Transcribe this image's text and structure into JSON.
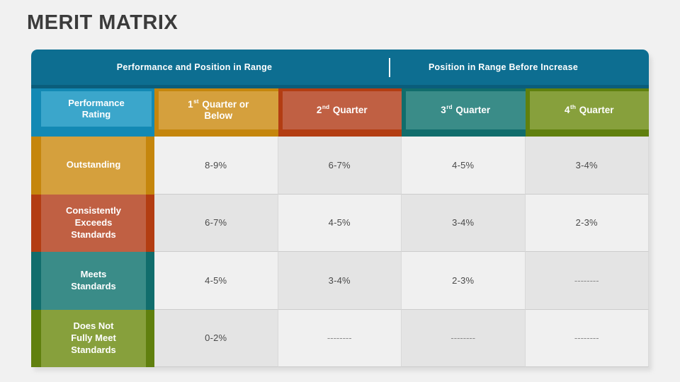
{
  "title": "MERIT MATRIX",
  "banner": {
    "left_label": "Performance and Position in Range",
    "right_label": "Position in Range Before Increase",
    "color": "#0d6e91"
  },
  "columns": [
    {
      "id": "rating",
      "label": "Performance Rating",
      "line1": "Performance",
      "line2": "Rating",
      "base_color": "#1389b4",
      "panel_color": "#3ba6cb"
    },
    {
      "id": "q1",
      "label": "1st Quarter or Below",
      "num": "1",
      "ord": "st",
      "rest": " Quarter or",
      "line2": "Below",
      "base_color": "#c5860d",
      "panel_color": "#d5a03d"
    },
    {
      "id": "q2",
      "label": "2nd Quarter",
      "num": "2",
      "ord": "nd",
      "rest": " Quarter",
      "line2": "",
      "base_color": "#b33d12",
      "panel_color": "#c06043"
    },
    {
      "id": "q3",
      "label": "3rd Quarter",
      "num": "3",
      "ord": "rd",
      "rest": " Quarter",
      "line2": "",
      "base_color": "#116d6c",
      "panel_color": "#3a8c88"
    },
    {
      "id": "q4",
      "label": "4th Quarter",
      "num": "4",
      "ord": "th",
      "rest": " Quarter",
      "line2": "",
      "base_color": "#60800e",
      "panel_color": "#87a03c"
    }
  ],
  "rows": [
    {
      "id": "outstanding",
      "label": "Outstanding",
      "lines": [
        "Outstanding"
      ],
      "base_color": "#c5860d",
      "panel_color": "#d5a03d",
      "values": [
        "8-9%",
        "6-7%",
        "4-5%",
        "3-4%"
      ]
    },
    {
      "id": "consistently-exceeds-standards",
      "label": "Consistently Exceeds Standards",
      "lines": [
        "Consistently",
        "Exceeds",
        "Standards"
      ],
      "base_color": "#b33d12",
      "panel_color": "#c06043",
      "values": [
        "6-7%",
        "4-5%",
        "3-4%",
        "2-3%"
      ]
    },
    {
      "id": "meets-standards",
      "label": "Meets Standards",
      "lines": [
        "Meets",
        "Standards"
      ],
      "base_color": "#116d6c",
      "panel_color": "#3a8c88",
      "values": [
        "4-5%",
        "3-4%",
        "2-3%",
        "--------"
      ]
    },
    {
      "id": "does-not-fully-meet-standards",
      "label": "Does Not Fully Meet Standards",
      "lines": [
        "Does Not",
        "Fully Meet",
        "Standards"
      ],
      "base_color": "#60800e",
      "panel_color": "#87a03c",
      "values": [
        "0-2%",
        "--------",
        "--------",
        "--------"
      ]
    }
  ],
  "chart_data": {
    "type": "table",
    "title": "MERIT MATRIX",
    "xlabel": "Position in Range Before Increase",
    "ylabel": "Performance Rating",
    "categories": [
      "1st Quarter or Below",
      "2nd Quarter",
      "3rd Quarter",
      "4th Quarter"
    ],
    "series": [
      {
        "name": "Outstanding",
        "values": [
          "8-9%",
          "6-7%",
          "4-5%",
          "3-4%"
        ]
      },
      {
        "name": "Consistently Exceeds Standards",
        "values": [
          "6-7%",
          "4-5%",
          "3-4%",
          "2-3%"
        ]
      },
      {
        "name": "Meets Standards",
        "values": [
          "4-5%",
          "3-4%",
          "2-3%",
          "--------"
        ]
      },
      {
        "name": "Does Not Fully Meet Standards",
        "values": [
          "0-2%",
          "--------",
          "--------",
          "--------"
        ]
      }
    ]
  }
}
